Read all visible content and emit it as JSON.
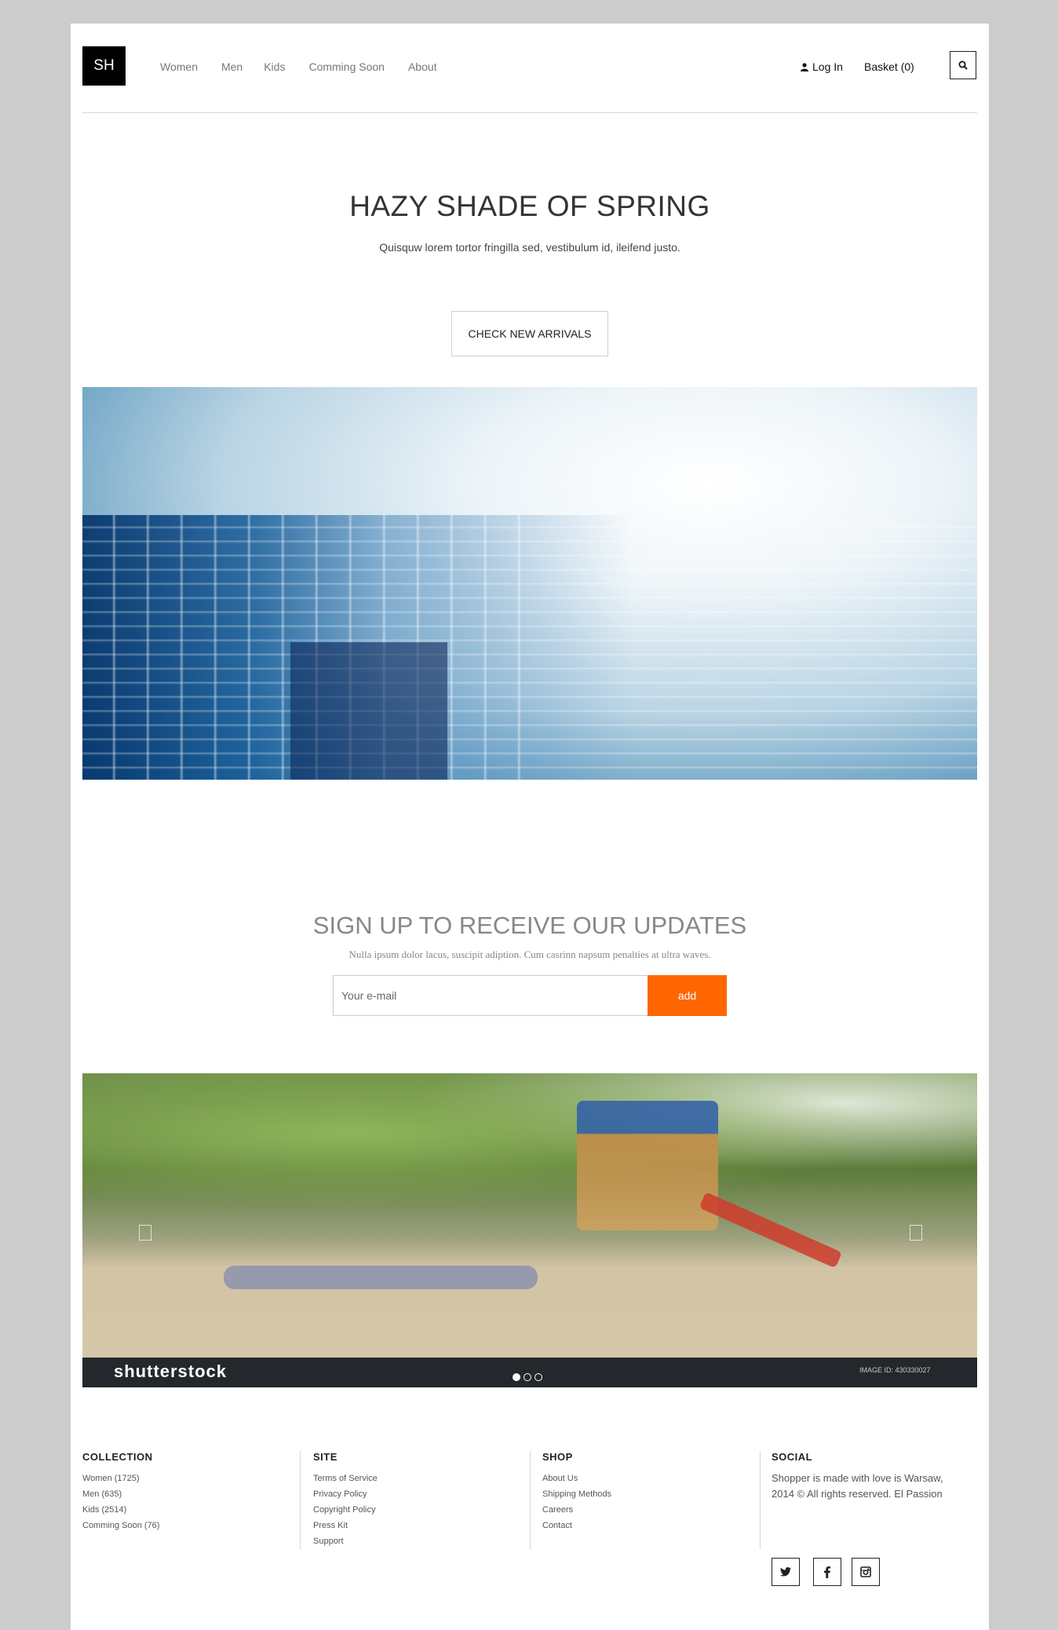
{
  "header": {
    "logo": "SH",
    "nav": [
      "Women",
      "Men",
      "Kids",
      "Comming Soon",
      "About"
    ],
    "login": "Log In",
    "basket": "Basket (0)"
  },
  "hero": {
    "title": "HAZY SHADE OF SPRING",
    "subtitle": "Quisquw lorem tortor fringilla sed, vestibulum id, ileifend justo.",
    "cta": "CHECK NEW ARRIVALS"
  },
  "signup": {
    "title": "SIGN UP TO RECEIVE OUR UPDATES",
    "subtitle": "Nulla ipsum dolor lacus, suscipit adiption. Cum casrinn napsum penalties at ultra waves.",
    "email_placeholder": "Your e-mail",
    "button": "add"
  },
  "slider": {
    "watermark": "shutterstock",
    "image_id": "IMAGE ID: 430330027",
    "dots": 3,
    "active_dot": 0
  },
  "footer": {
    "collection": {
      "heading": "COLLECTION",
      "items": [
        "Women (1725)",
        "Men (635)",
        "Kids (2514)",
        "Comming Soon (76)"
      ]
    },
    "site": {
      "heading": "SITE",
      "items": [
        "Terms of Service",
        "Privacy Policy",
        "Copyright Policy",
        "Press Kit",
        "Support"
      ]
    },
    "shop": {
      "heading": "SHOP",
      "items": [
        "About Us",
        "Shipping Methods",
        "Careers",
        "Contact"
      ]
    },
    "social": {
      "heading": "SOCIAL",
      "text": "Shopper is made with love is Warsaw, 2014 © All rights reserved. El Passion",
      "icons": [
        "twitter-icon",
        "facebook-icon",
        "instagram-icon"
      ]
    }
  },
  "colors": {
    "accent": "#ff6600",
    "background": "#cccccc"
  }
}
